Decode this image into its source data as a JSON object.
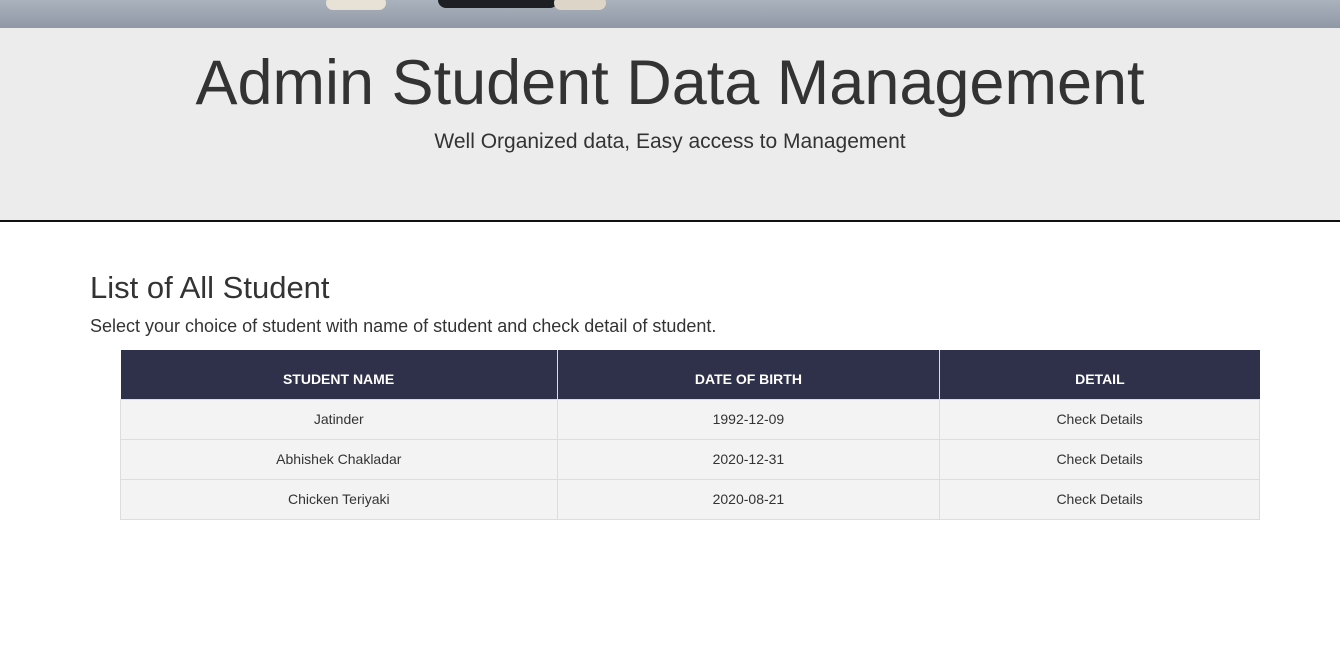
{
  "hero": {
    "title": "Admin Student Data Management",
    "subtitle": "Well Organized data, Easy access to Management"
  },
  "section": {
    "heading": "List of All Student",
    "description": "Select your choice of student with name of student and check detail of student."
  },
  "table": {
    "headers": [
      "STUDENT NAME",
      "DATE OF BIRTH",
      "DETAIL"
    ],
    "rows": [
      {
        "name": "Jatinder",
        "dob": "1992-12-09",
        "detail": "Check Details"
      },
      {
        "name": "Abhishek Chakladar",
        "dob": "2020-12-31",
        "detail": "Check Details"
      },
      {
        "name": "Chicken Teriyaki",
        "dob": "2020-08-21",
        "detail": "Check Details"
      }
    ]
  },
  "colors": {
    "header_bg": "#2e3149",
    "jumbotron_bg": "#ececec",
    "row_bg": "#f3f3f3"
  }
}
